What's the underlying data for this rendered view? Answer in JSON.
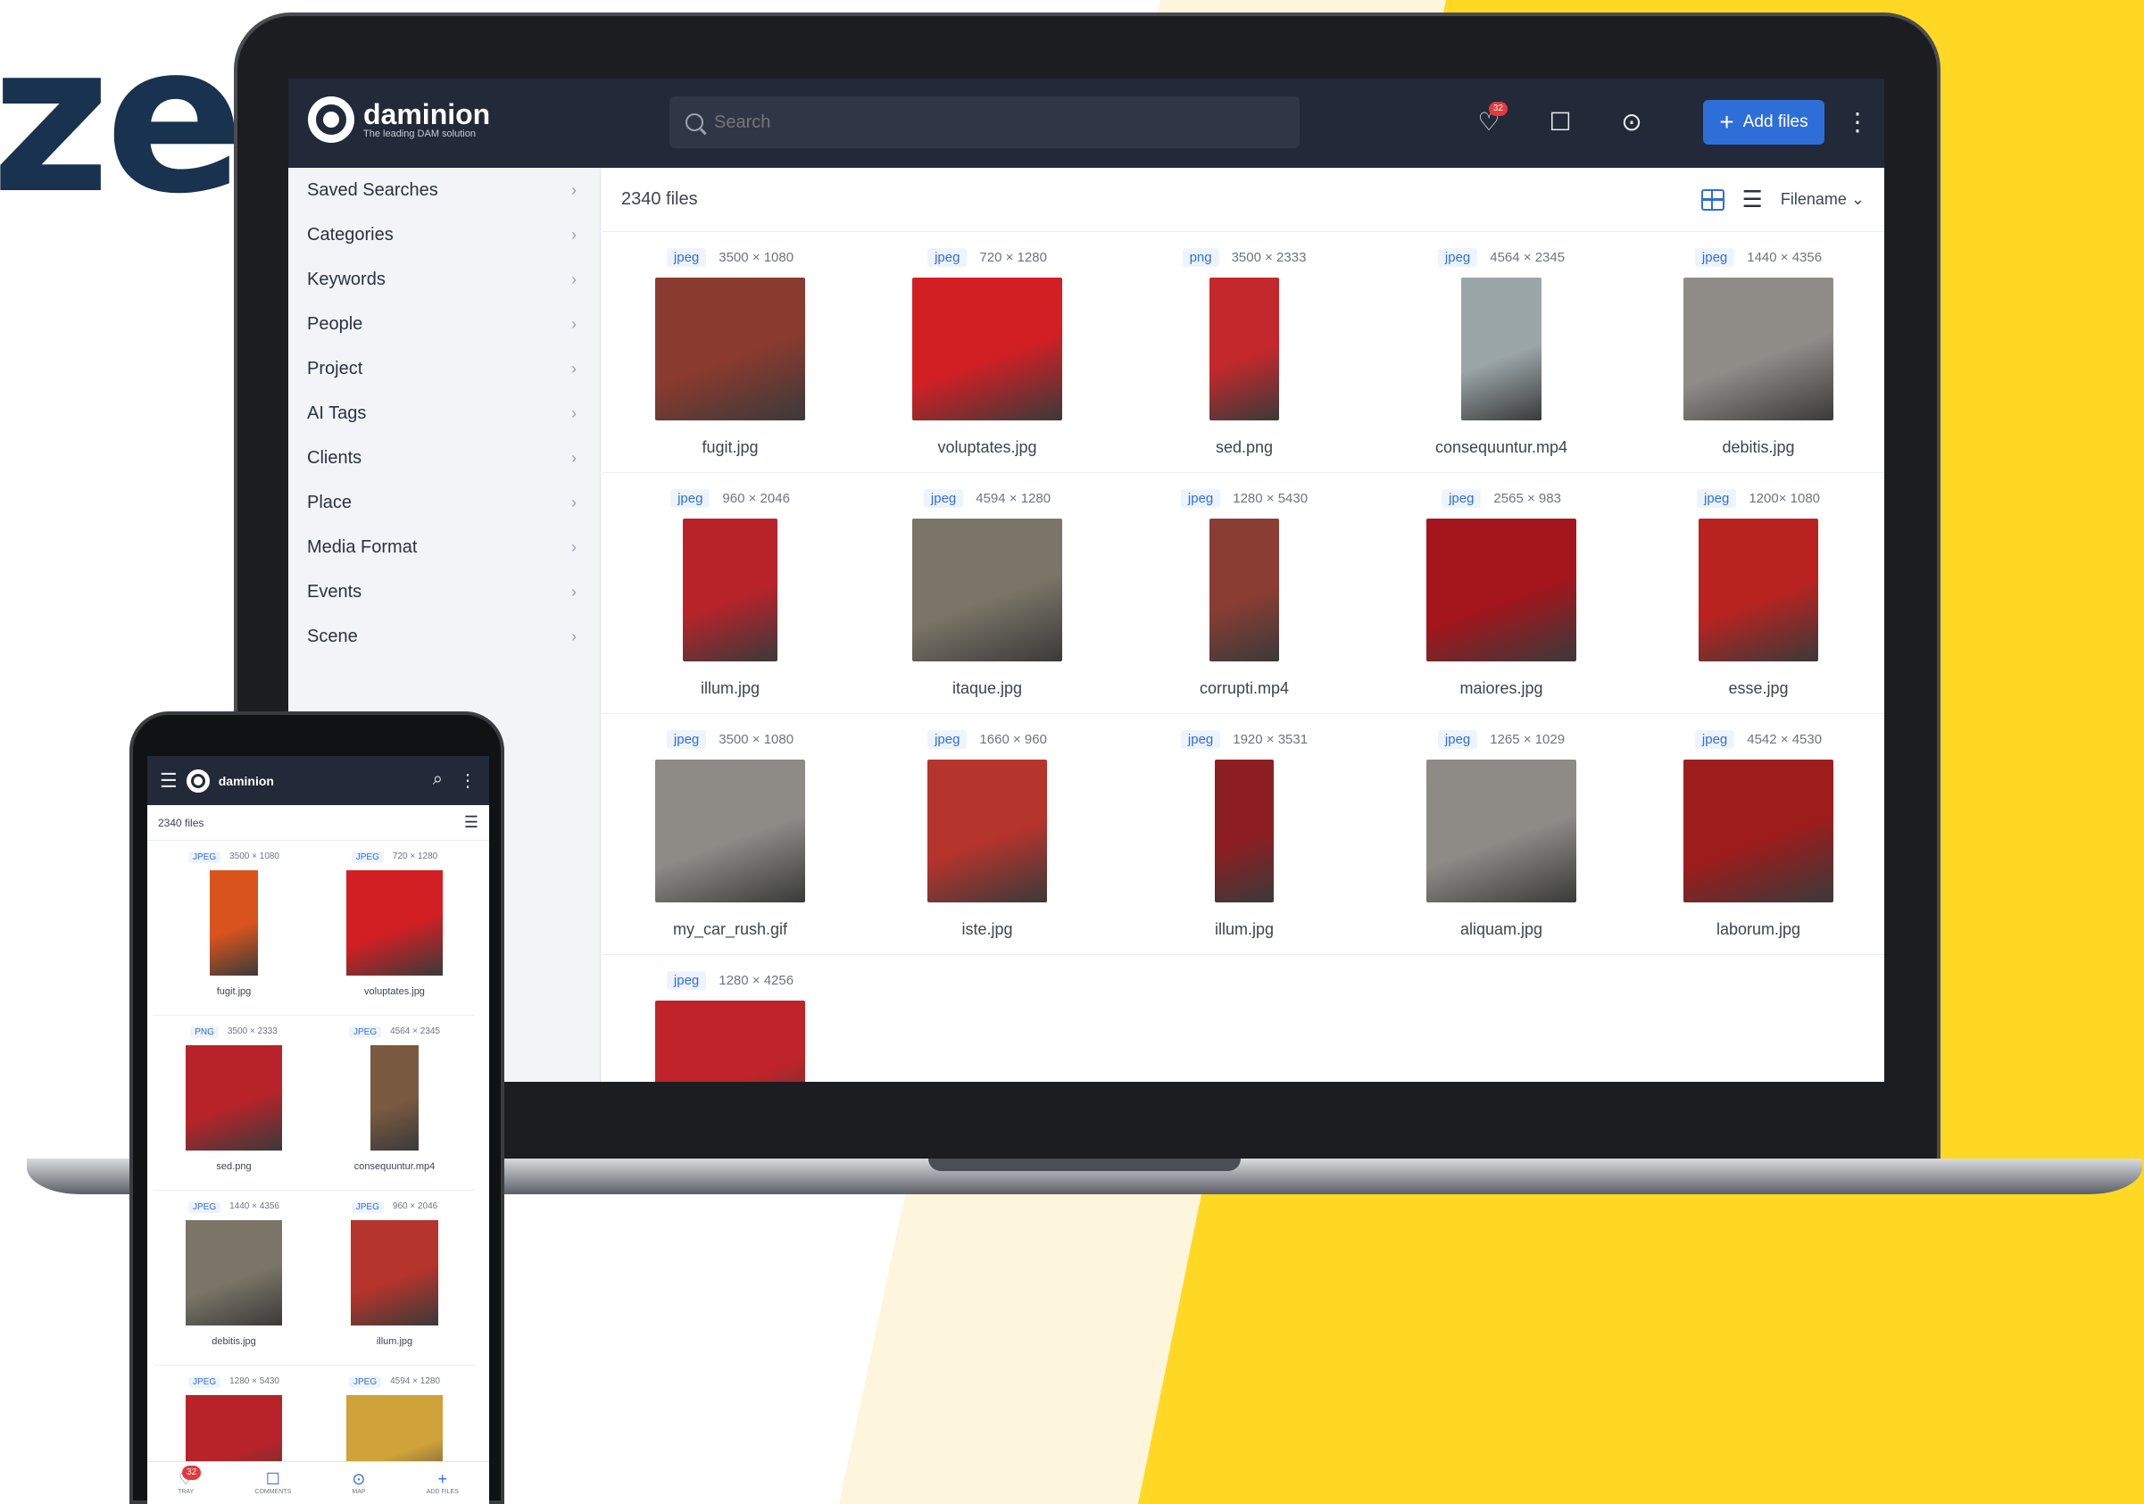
{
  "headline": "ze",
  "colors": {
    "accent": "#2e6ed8",
    "header_bg": "#222938",
    "brand_yellow": "#ffd823",
    "headline": "#18324f"
  },
  "app": {
    "brand_name": "daminion",
    "brand_tagline": "The leading DAM solution",
    "search_placeholder": "Search",
    "favorites_badge": "32",
    "add_files_label": "Add files",
    "header_icons": [
      "heart-icon",
      "comments-icon",
      "map-pin-icon",
      "kebab-menu-icon"
    ]
  },
  "sidebar": {
    "items": [
      {
        "label": "Saved Searches"
      },
      {
        "label": "Categories"
      },
      {
        "label": "Keywords"
      },
      {
        "label": "People"
      },
      {
        "label": "Project"
      },
      {
        "label": "AI Tags"
      },
      {
        "label": "Clients"
      },
      {
        "label": "Place"
      },
      {
        "label": "Media Format"
      },
      {
        "label": "Events"
      },
      {
        "label": "Scene"
      }
    ]
  },
  "main": {
    "file_count": "2340 files",
    "sort_label": "Filename",
    "files": [
      {
        "format": "jpeg",
        "dims": "3500 × 1080",
        "name": "fugit.jpg",
        "color": "#8a3a2e",
        "w": 168
      },
      {
        "format": "jpeg",
        "dims": "720 × 1280",
        "name": "voluptates.jpg",
        "color": "#d21f24",
        "w": 168
      },
      {
        "format": "png",
        "dims": "3500 × 2333",
        "name": "sed.png",
        "color": "#c4282c",
        "w": 78
      },
      {
        "format": "jpeg",
        "dims": "4564 × 2345",
        "name": "consequuntur.mp4",
        "color": "#9aa6a8",
        "w": 90
      },
      {
        "format": "jpeg",
        "dims": "1440 × 4356",
        "name": "debitis.jpg",
        "color": "#8f8d88",
        "w": 168
      },
      {
        "format": "jpeg",
        "dims": "960 × 2046",
        "name": "illum.jpg",
        "color": "#b8232a",
        "w": 106
      },
      {
        "format": "jpeg",
        "dims": "4594 × 1280",
        "name": "itaque.jpg",
        "color": "#7a7566",
        "w": 168
      },
      {
        "format": "jpeg",
        "dims": "1280 × 5430",
        "name": "corrupti.mp4",
        "color": "#8a3d33",
        "w": 78
      },
      {
        "format": "jpeg",
        "dims": "2565 × 983",
        "name": "maiores.jpg",
        "color": "#a5151c",
        "w": 168
      },
      {
        "format": "jpeg",
        "dims": "1200× 1080",
        "name": "esse.jpg",
        "color": "#b9231f",
        "w": 134
      },
      {
        "format": "jpeg",
        "dims": "3500 × 1080",
        "name": "my_car_rush.gif",
        "color": "#8c8b86",
        "w": 168
      },
      {
        "format": "jpeg",
        "dims": "1660 × 960",
        "name": "iste.jpg",
        "color": "#b5342c",
        "w": 134
      },
      {
        "format": "jpeg",
        "dims": "1920 × 3531",
        "name": "illum.jpg",
        "color": "#8d1e22",
        "w": 66
      },
      {
        "format": "jpeg",
        "dims": "1265 × 1029",
        "name": "aliquam.jpg",
        "color": "#8c8b86",
        "w": 168
      },
      {
        "format": "jpeg",
        "dims": "4542 × 4530",
        "name": "laborum.jpg",
        "color": "#9d1c1c",
        "w": 168
      },
      {
        "format": "jpeg",
        "dims": "1280 × 4256",
        "name": "",
        "color": "#c0242a",
        "w": 168
      }
    ]
  },
  "phone": {
    "brand_name": "daminion",
    "file_count": "2340 files",
    "files": [
      {
        "format": "JPEG",
        "dims": "3500 × 1080",
        "name": "fugit.jpg",
        "color": "#d9541c",
        "w": 54
      },
      {
        "format": "JPEG",
        "dims": "720 × 1280",
        "name": "voluptates.jpg",
        "color": "#d21f24",
        "w": 108
      },
      {
        "format": "PNG",
        "dims": "3500 × 2333",
        "name": "sed.png",
        "color": "#b8232a",
        "w": 108
      },
      {
        "format": "JPEG",
        "dims": "4564 × 2345",
        "name": "consequuntur.mp4",
        "color": "#7a5a40",
        "w": 54
      },
      {
        "format": "JPEG",
        "dims": "1440 × 4356",
        "name": "debitis.jpg",
        "color": "#7a7566",
        "w": 108
      },
      {
        "format": "JPEG",
        "dims": "960 × 2046",
        "name": "illum.jpg",
        "color": "#b5342c",
        "w": 98
      },
      {
        "format": "JPEG",
        "dims": "1280 × 5430",
        "name": "",
        "color": "#b8232a",
        "w": 108
      },
      {
        "format": "JPEG",
        "dims": "4594 × 1280",
        "name": "",
        "color": "#d0a23a",
        "w": 108
      }
    ],
    "nav": [
      {
        "label": "TRAY",
        "icon": "heart-icon",
        "badge": "32"
      },
      {
        "label": "COMMENTS",
        "icon": "comments-icon"
      },
      {
        "label": "MAP",
        "icon": "map-pin-icon"
      },
      {
        "label": "ADD FILES",
        "icon": "plus-icon"
      }
    ]
  }
}
